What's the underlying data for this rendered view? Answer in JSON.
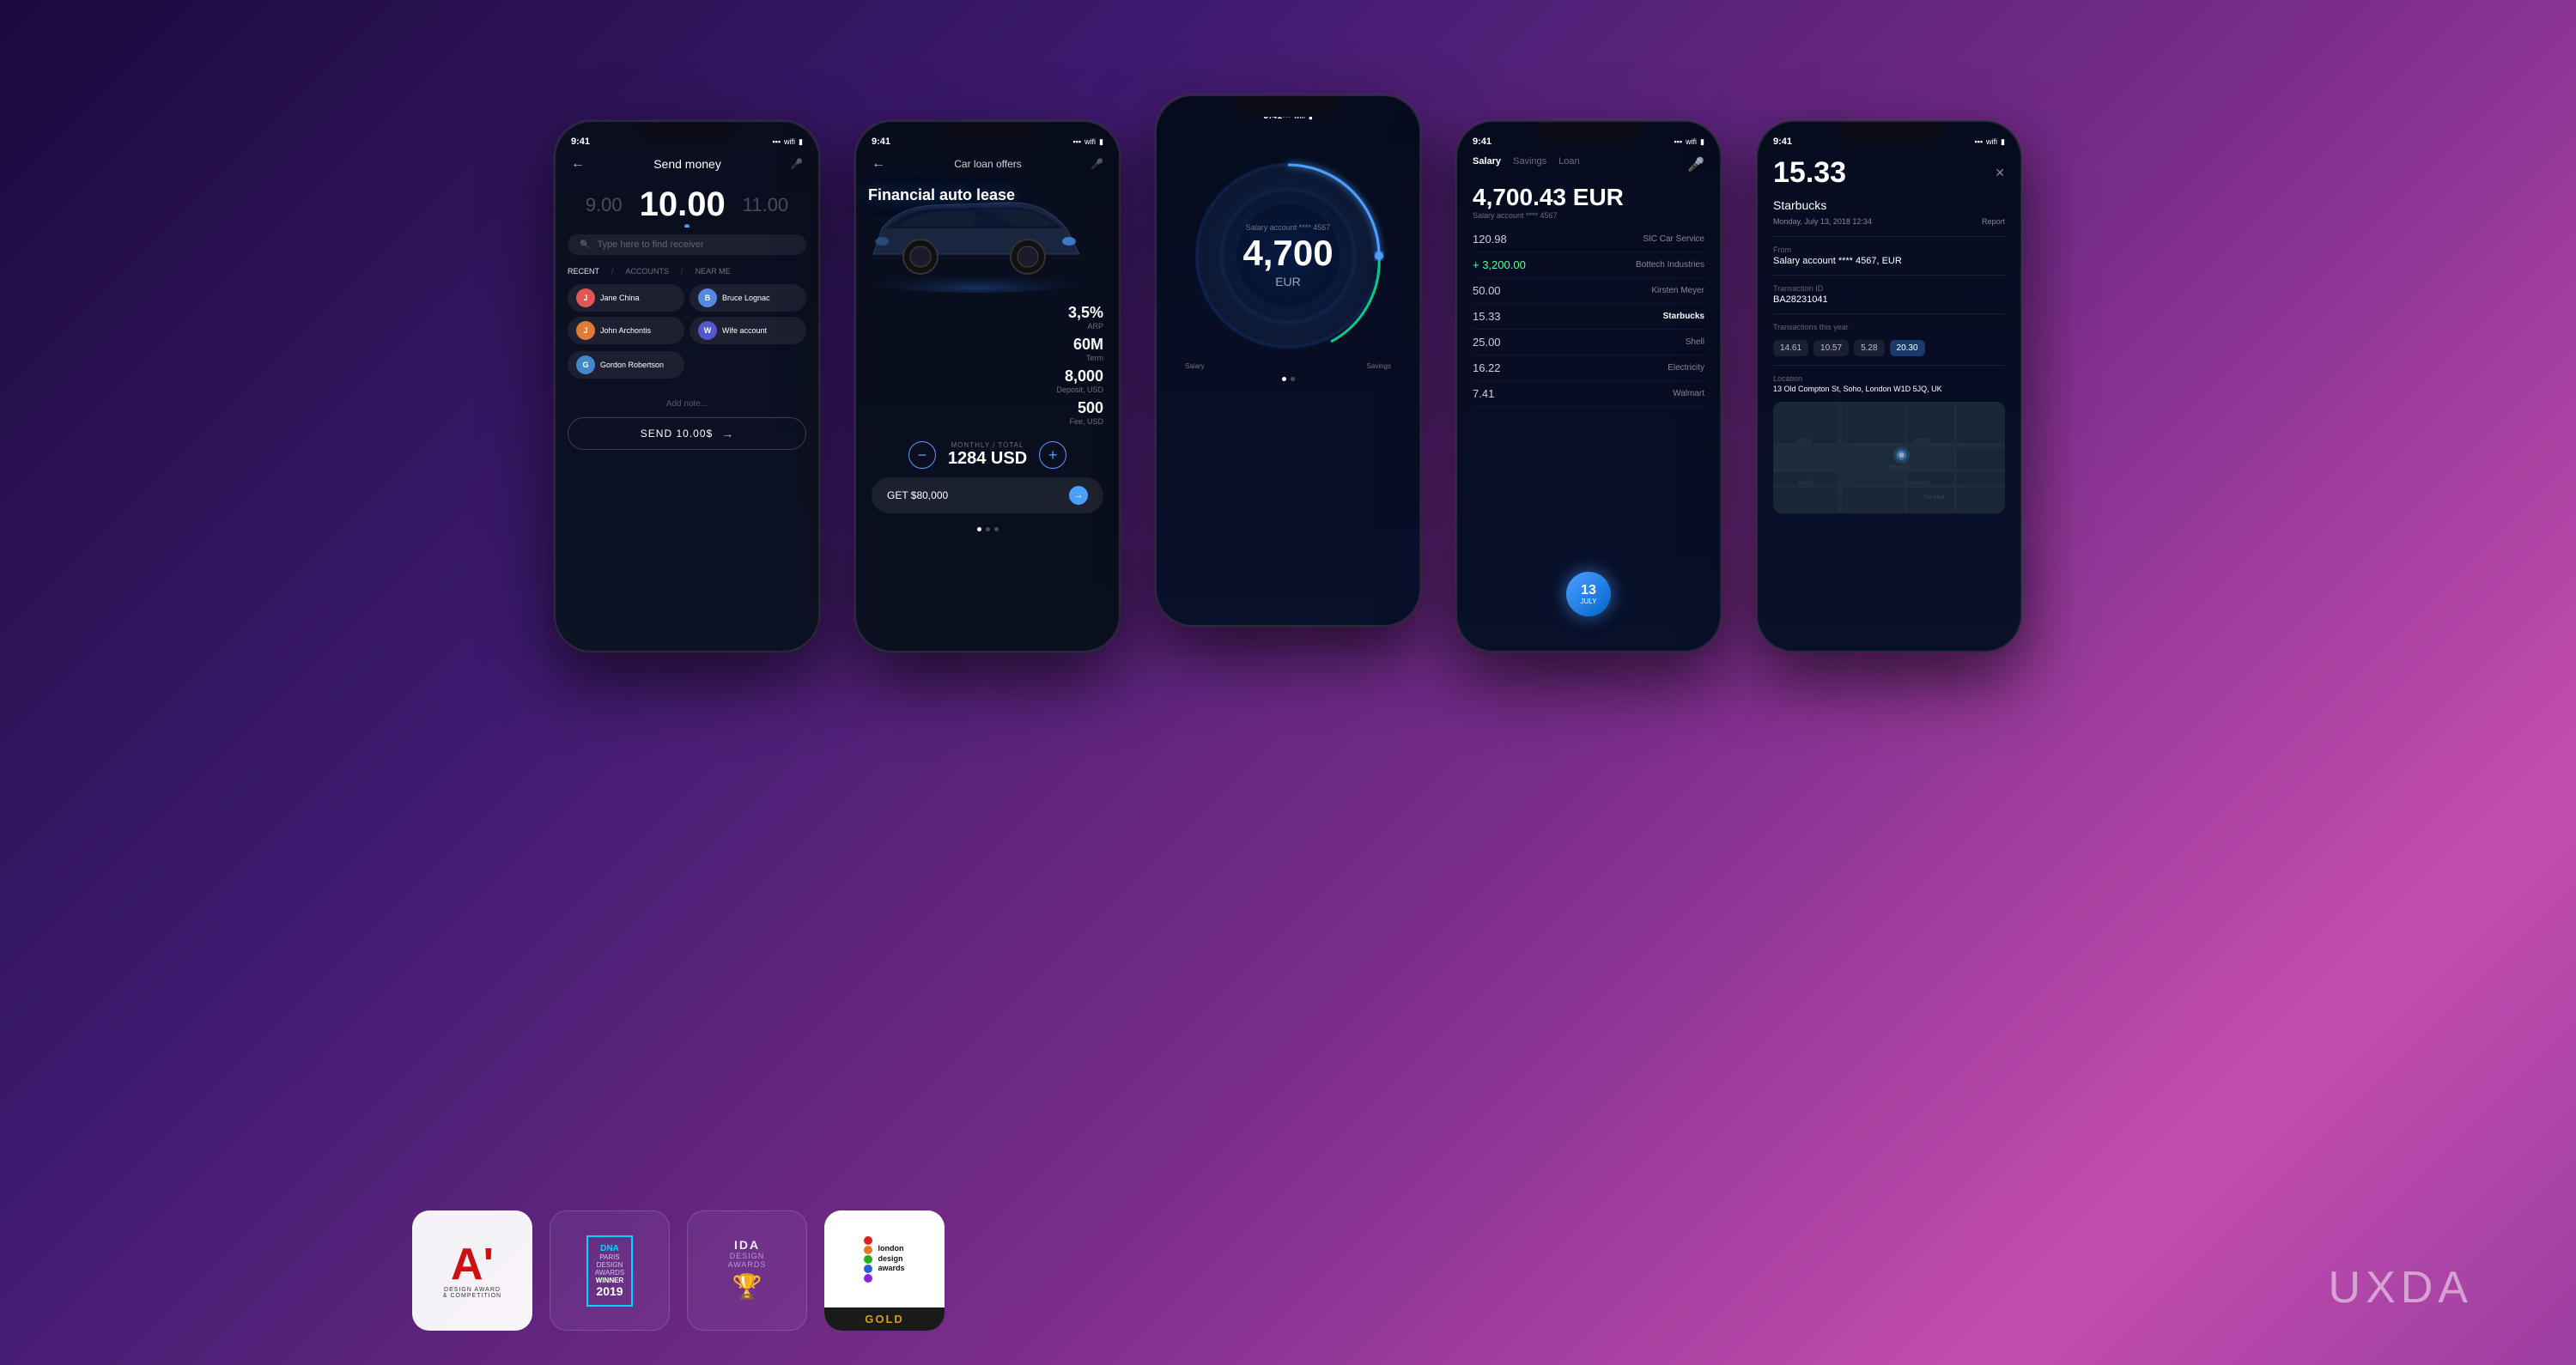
{
  "brand": {
    "name": "UXDA"
  },
  "phone1": {
    "status_time": "9:41",
    "title": "Send money",
    "amount_left": "9.00",
    "amount_main": "10.00",
    "amount_right": "11.00",
    "search_placeholder": "Type here to find receiver",
    "tabs": [
      "RECENT",
      "ACCOUNTS",
      "NEAR ME"
    ],
    "contacts": [
      {
        "name": "Jane China",
        "color": "#e05555"
      },
      {
        "name": "Bruce Lognac",
        "color": "#5588e0"
      },
      {
        "name": "John Archontis",
        "color": "#e07b35"
      },
      {
        "name": "Wife account",
        "color": "#5555cc"
      },
      {
        "name": "Gordon Robertson",
        "color": "#4488cc"
      }
    ],
    "add_note_label": "Add note...",
    "send_label": "SEND 10.00$"
  },
  "phone2": {
    "status_time": "9:41",
    "header_label": "Car loan offers",
    "title": "Financial auto lease",
    "stats": [
      {
        "value": "3,5%",
        "label": "ARP"
      },
      {
        "value": "60M",
        "label": "Term"
      },
      {
        "value": "8,000",
        "label": "Deposit, USD"
      },
      {
        "value": "500",
        "label": "Fee, USD"
      }
    ],
    "monthly_label": "MONTHLY / TOTAL",
    "monthly_value": "1284 USD",
    "get_label": "GET $80,000"
  },
  "phone3": {
    "status_time": "9:41",
    "account_label": "Salary account **** 4567",
    "amount": "4,700",
    "currency": "EUR",
    "gauge_left": "Salary",
    "gauge_right": "Savings"
  },
  "phone4": {
    "status_time": "9:41",
    "tabs": [
      "Salary",
      "Savings",
      "Loan"
    ],
    "balance": "4,700.43 EUR",
    "account": "Salary account **** 4567",
    "transactions": [
      {
        "amount": "120.98",
        "merchant": "SIC Car Service",
        "positive": false
      },
      {
        "amount": "+ 3,200.00",
        "merchant": "Bottech Industries",
        "positive": true
      },
      {
        "amount": "50.00",
        "merchant": "Kirsten Meyer",
        "positive": false
      },
      {
        "amount": "15.33",
        "merchant": "Starbucks",
        "positive": false
      },
      {
        "amount": "25.00",
        "merchant": "Shell",
        "positive": false
      },
      {
        "amount": "16.22",
        "merchant": "Electricity",
        "positive": false
      },
      {
        "amount": "7.41",
        "merchant": "Walmart",
        "positive": false
      }
    ],
    "calendar_num": "13",
    "calendar_month": "JULY"
  },
  "phone5": {
    "status_time": "9:41",
    "amount": "15.33",
    "merchant": "Starbucks",
    "date": "Monday, July 13, 2018  12:34",
    "report_label": "Report",
    "from_label": "From",
    "from_value": "Salary account **** 4567, EUR",
    "tx_id_label": "Transaction ID",
    "tx_id_value": "BA28231041",
    "tx_year_label": "Transactions this year",
    "tx_values": [
      "14.61",
      "10.57",
      "5.28",
      "20.30"
    ],
    "location_label": "Location",
    "location_value": "13 Old Compton St, Soho, London W1D 5JQ, UK"
  },
  "awards": [
    {
      "id": "a-design",
      "label": "A' Design Award"
    },
    {
      "id": "dna-paris",
      "label": "DNA Paris Design Awards Winner 2019"
    },
    {
      "id": "ida",
      "label": "IDA Design Awards"
    },
    {
      "id": "london",
      "label": "london design awards GOLD"
    }
  ]
}
